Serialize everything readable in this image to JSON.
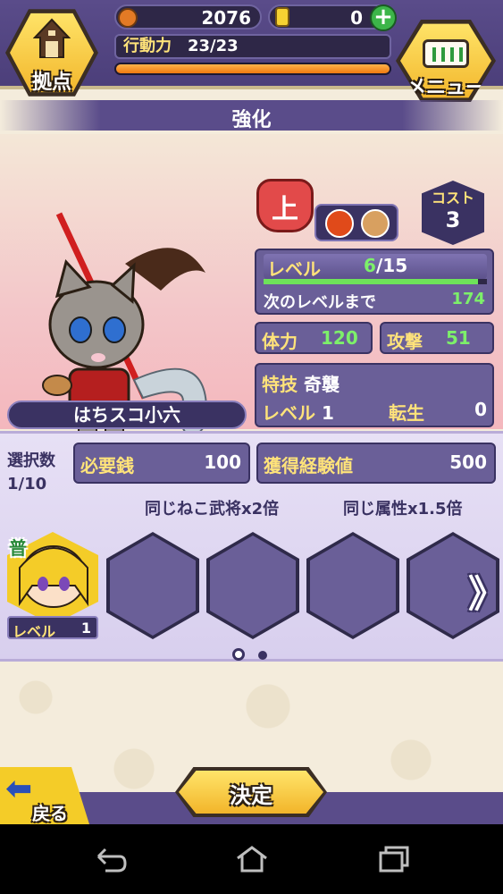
{
  "header": {
    "base_label": "拠点",
    "menu_label": "メニュー",
    "coins": "2076",
    "gold": "0",
    "plus": "+",
    "action_label": "行動力",
    "action_value": "23/23",
    "action_fraction": 1.0
  },
  "title": "強化",
  "character": {
    "name": "はちスコ小六",
    "rank": "上",
    "cost_label": "コスト",
    "cost_value": "3",
    "attributes": [
      "fire-icon",
      "claw-icon"
    ],
    "level_label": "レベル",
    "level_current": "6",
    "level_max": "/15",
    "level_fraction": 0.96,
    "next_label": "次のレベルまで",
    "next_value": "174",
    "hp_label": "体力",
    "hp_value": "120",
    "atk_label": "攻撃",
    "atk_value": "51",
    "skill_label": "特技",
    "skill_name": "奇襲",
    "skill_level_label": "レベル",
    "skill_level_value": "1",
    "rebirth_label": "転生",
    "rebirth_value": "0"
  },
  "material": {
    "select_label": "選択数",
    "select_value": "1/10",
    "money_label": "必要銭",
    "money_value": "100",
    "exp_label": "獲得経験値",
    "exp_value": "500",
    "bonus1": "同じねこ武将x2倍",
    "bonus2": "同じ属性x1.5倍",
    "slot1": {
      "rarity": "普",
      "level_label": "レベル",
      "level_value": "1"
    },
    "next_arrow": "》"
  },
  "footer": {
    "back_label": "戻る",
    "back_arrow": "⬅",
    "decide_label": "決定"
  },
  "colors": {
    "accent_purple": "#5a4c8a",
    "accent_yellow": "#f4cc28",
    "value_green": "#7df06a"
  }
}
